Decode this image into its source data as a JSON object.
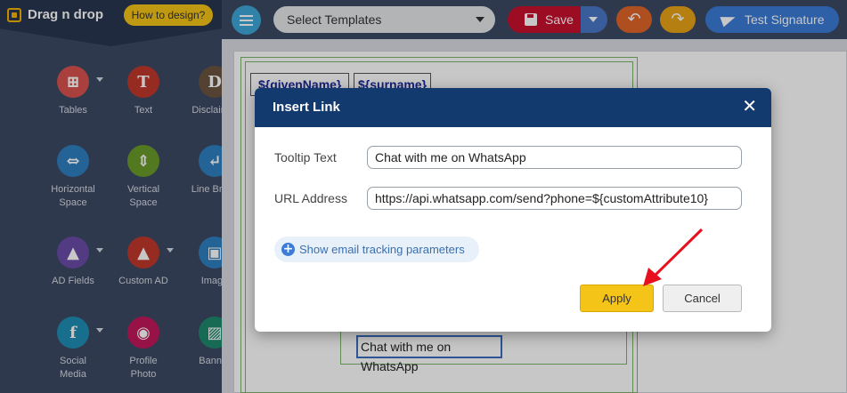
{
  "sidebar": {
    "title": "Drag n drop",
    "how_to": "How to design?",
    "tools": [
      {
        "label": "Tables",
        "icon": "table-icon",
        "color": "#d9534f",
        "glyph": "⊞",
        "dropdown": true
      },
      {
        "label": "Text",
        "icon": "text-icon",
        "color": "#c0392b",
        "glyph": "T",
        "dropdown": false
      },
      {
        "label": "Disclaimer",
        "icon": "disclaimer-icon",
        "color": "#6b5540",
        "glyph": "D",
        "dropdown": false
      },
      {
        "label": "Horizontal\nSpace",
        "icon": "horizontal-space-icon",
        "color": "#2e7fc0",
        "glyph": "⇔",
        "dropdown": false
      },
      {
        "label": "Vertical\nSpace",
        "icon": "vertical-space-icon",
        "color": "#6a9b2a",
        "glyph": "⇕",
        "dropdown": false
      },
      {
        "label": "Line Break",
        "icon": "line-break-icon",
        "color": "#2e7fc0",
        "glyph": "↵",
        "dropdown": false
      },
      {
        "label": "AD Fields",
        "icon": "ad-fields-icon",
        "color": "#6a4ca8",
        "glyph": "▲",
        "dropdown": true
      },
      {
        "label": "Custom AD",
        "icon": "custom-ad-icon",
        "color": "#c0392b",
        "glyph": "▲",
        "dropdown": true
      },
      {
        "label": "Image",
        "icon": "image-icon",
        "color": "#2e7fc0",
        "glyph": "▣",
        "dropdown": false
      },
      {
        "label": "Social\nMedia",
        "icon": "social-media-icon",
        "color": "#1f8fb5",
        "glyph": "f",
        "dropdown": true
      },
      {
        "label": "Profile\nPhoto",
        "icon": "profile-photo-icon",
        "color": "#c2185b",
        "glyph": "◉",
        "dropdown": false
      },
      {
        "label": "Banner",
        "icon": "banner-icon",
        "color": "#1e8a6e",
        "glyph": "▨",
        "dropdown": false
      }
    ]
  },
  "toolbar": {
    "select_templates": "Select Templates",
    "save": "Save",
    "undo_glyph": "↶",
    "redo_glyph": "↷",
    "test_signature": "Test Signature"
  },
  "canvas": {
    "given_name": "${givenName}",
    "surname": "${surname}",
    "link_text": "Chat with me on WhatsApp"
  },
  "modal": {
    "title": "Insert Link",
    "close_glyph": "✕",
    "tooltip_label": "Tooltip Text",
    "tooltip_value": "Chat with me on WhatsApp",
    "url_label": "URL Address",
    "url_value": "https://api.whatsapp.com/send?phone=${customAttribute10}",
    "tracking_link": "Show email tracking parameters",
    "apply": "Apply",
    "cancel": "Cancel"
  },
  "colors": {
    "sidebar_bg": "#3d4a63",
    "modal_header": "#133a6e",
    "apply_yellow": "#f5c418",
    "annotation_arrow": "#e8101e"
  }
}
